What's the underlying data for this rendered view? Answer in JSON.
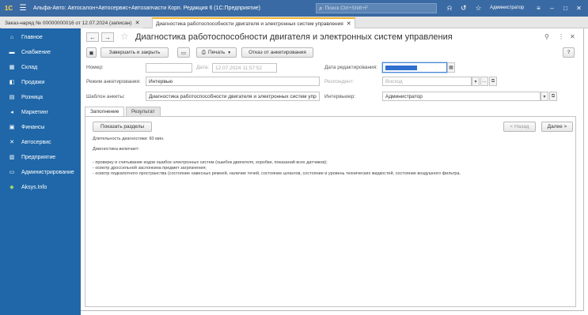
{
  "titlebar": {
    "logo": "1С",
    "title": "Альфа-Авто: Автосалон+Автосервис+Автозапчасти Корп. Редакция 6  (1С:Предприятие)",
    "search_placeholder": "Поиск Ctrl+Shift+F",
    "user": "Администратор"
  },
  "tabs": [
    {
      "label": "Заказ-наряд № 00000000016 от 12.07.2024 (записан)"
    },
    {
      "label": "Диагностика работоспособности двигателя и электронных систем управления"
    }
  ],
  "sidebar": {
    "items": [
      {
        "label": "Главное",
        "icon": "home-icon",
        "glyph": "⌂"
      },
      {
        "label": "Снабжение",
        "icon": "truck-icon",
        "glyph": "▬"
      },
      {
        "label": "Склад",
        "icon": "warehouse-icon",
        "glyph": "▦"
      },
      {
        "label": "Продажи",
        "icon": "cart-icon",
        "glyph": "◧"
      },
      {
        "label": "Розница",
        "icon": "store-icon",
        "glyph": "▤"
      },
      {
        "label": "Маркетинг",
        "icon": "marketing-icon",
        "glyph": "◂"
      },
      {
        "label": "Финансы",
        "icon": "finance-icon",
        "glyph": "▣"
      },
      {
        "label": "Автосервис",
        "icon": "wrench-icon",
        "glyph": "✕"
      },
      {
        "label": "Предприятие",
        "icon": "enterprise-icon",
        "glyph": "▥"
      },
      {
        "label": "Администрирование",
        "icon": "admin-icon",
        "glyph": "▭"
      },
      {
        "label": "Aksys.Info",
        "icon": "aksys-icon",
        "glyph": "◆"
      }
    ]
  },
  "doc": {
    "title": "Диагностика работоспособности двигателя и электронных систем управления"
  },
  "toolbar": {
    "finish_label": "Завершить и закрыть",
    "print_label": "Печать",
    "cancel_label": "Отказ от анкетирования",
    "help_label": "?"
  },
  "form": {
    "number_label": "Номер:",
    "number_value": "",
    "date_label": "Дата:",
    "date_value": "12.07.2024 11:57:52",
    "edit_date_label": "Дата редактирования:",
    "mode_label": "Режим анкетирования:",
    "mode_value": "Интервью",
    "respondent_label": "Респондент:",
    "respondent_value": "Восход",
    "template_label": "Шаблон анкеты:",
    "template_value": "Диагностика работоспособности двигателя и электронных систем упр",
    "interviewer_label": "Интервьюер:",
    "interviewer_value": "Администратор"
  },
  "formtabs": [
    {
      "label": "Заполнение"
    },
    {
      "label": "Результат"
    }
  ],
  "content": {
    "show_sections": "Показать разделы",
    "back": "< Назад",
    "next": "Далее >",
    "duration": "Длительность диагностики: 60 мин.",
    "includes": "Диагностика включает:",
    "items": [
      "- проверку и считывание кодов ошибок электронных систем (ошибок двигателя, коробки, показаний всех датчиков);",
      "- осмотр дроссельной заслонкина предмет загрязнения;",
      "- осмотр подкапотного пространства (состояние навесных ремней, наличие течей, состояние шлангов, состояние и уровень технических жидкостей, состояние воздушного фильтра."
    ]
  }
}
